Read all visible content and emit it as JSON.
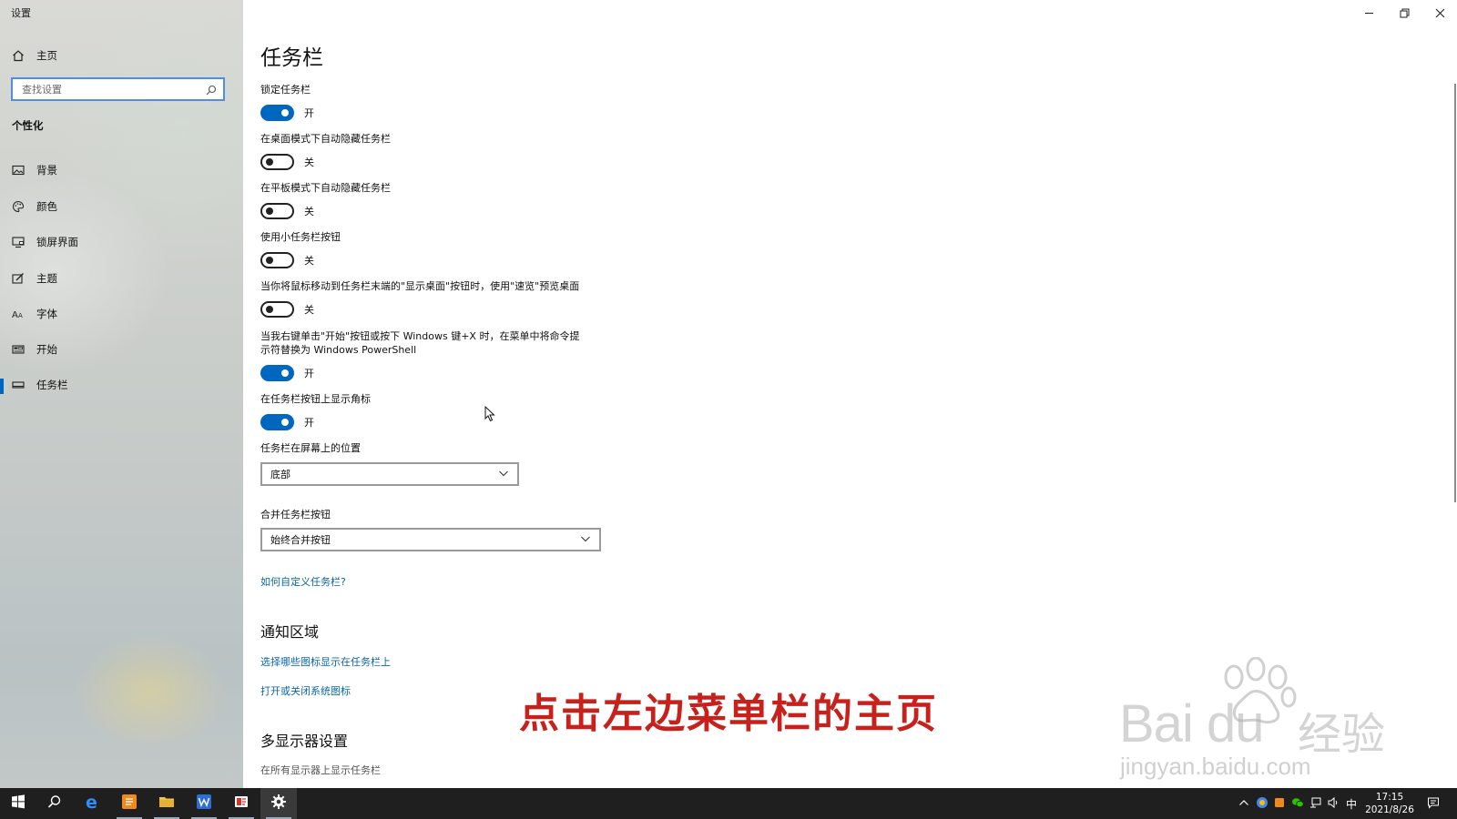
{
  "window": {
    "title": "设置"
  },
  "sidebar": {
    "home_label": "主页",
    "search_placeholder": "查找设置",
    "section_title": "个性化",
    "items": [
      {
        "label": "背景",
        "icon": "image-icon"
      },
      {
        "label": "颜色",
        "icon": "palette-icon"
      },
      {
        "label": "锁屏界面",
        "icon": "lock-screen-icon"
      },
      {
        "label": "主题",
        "icon": "theme-icon"
      },
      {
        "label": "字体",
        "icon": "font-icon"
      },
      {
        "label": "开始",
        "icon": "start-icon"
      },
      {
        "label": "任务栏",
        "icon": "taskbar-icon",
        "active": true
      }
    ]
  },
  "main": {
    "title": "任务栏",
    "toggles": [
      {
        "label": "锁定任务栏",
        "on": true,
        "state": "开"
      },
      {
        "label": "在桌面模式下自动隐藏任务栏",
        "on": false,
        "state": "关"
      },
      {
        "label": "在平板模式下自动隐藏任务栏",
        "on": false,
        "state": "关"
      },
      {
        "label": "使用小任务栏按钮",
        "on": false,
        "state": "关"
      },
      {
        "label": "当你将鼠标移动到任务栏末端的\"显示桌面\"按钮时，使用\"速览\"预览桌面",
        "on": false,
        "state": "关"
      },
      {
        "label_line1": "当我右键单击\"开始\"按钮或按下 Windows 键+X 时，在菜单中将命令提",
        "label_line2": "示符替换为 Windows PowerShell",
        "on": true,
        "state": "开"
      },
      {
        "label": "在任务栏按钮上显示角标",
        "on": true,
        "state": "开"
      }
    ],
    "position_label": "任务栏在屏幕上的位置",
    "position_value": "底部",
    "combine_label": "合并任务栏按钮",
    "combine_value": "始终合并按钮",
    "help_link": "如何自定义任务栏?",
    "notification_heading": "通知区域",
    "notification_link1": "选择哪些图标显示在任务栏上",
    "notification_link2": "打开或关闭系统图标",
    "multi_display_heading": "多显示器设置",
    "multi_display_label": "在所有显示器上显示任务栏"
  },
  "overlay": {
    "caption": "点击左边菜单栏的主页",
    "watermark_logo": "Bai du",
    "watermark_cn": "经验",
    "watermark_url": "jingyan.baidu.com"
  },
  "taskbar": {
    "apps": [
      "start-icon",
      "search-icon",
      "edge-icon",
      "orange-app-icon",
      "file-explorer-icon",
      "wps-writer-icon",
      "red-app-icon",
      "settings-icon"
    ],
    "ime": "中",
    "time": "17:15",
    "date": "2021/8/26"
  },
  "colors": {
    "accent": "#0067c0",
    "link": "#0a66a8",
    "caption": "#c8201a",
    "taskbar": "#1f1f1f"
  }
}
